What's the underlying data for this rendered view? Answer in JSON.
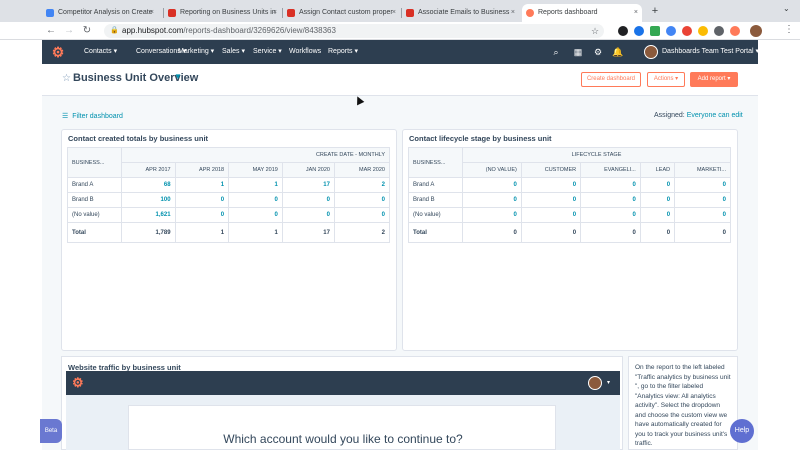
{
  "browser": {
    "tabs": [
      {
        "title": "Competitor Analysis on Create",
        "favicon_color": "#4285f4"
      },
      {
        "title": "Reporting on Business Units in",
        "favicon_color": "#d93025"
      },
      {
        "title": "Assign Contact custom proper",
        "favicon_color": "#d93025"
      },
      {
        "title": "Associate Emails to Business",
        "favicon_color": "#d93025"
      },
      {
        "title": "Reports dashboard",
        "favicon_color": "#ff7a59"
      }
    ],
    "close_glyph": "×",
    "new_tab_glyph": "+",
    "url_host": "app.hubspot.com",
    "url_path": "/reports-dashboard/3269626/view/8438363"
  },
  "hs_nav": {
    "logo_glyph": "⚙",
    "menu": [
      "Contacts ▾",
      "Conversations ▾",
      "Marketing ▾",
      "Sales ▾",
      "Service ▾",
      "Workflows",
      "Reports ▾"
    ],
    "portal_name": "Dashboards Team Test Portal ▾"
  },
  "header": {
    "star_glyph": "☆",
    "title": "Business Unit Overview",
    "caret": "▼",
    "create_dashboard": "Create dashboard",
    "actions": "Actions ▾",
    "add_report": "Add report ▾"
  },
  "filters": {
    "filter_label": "Filter dashboard",
    "assigned_label": "Assigned:",
    "assigned_value": "Everyone can edit"
  },
  "report1": {
    "title": "Contact created totals by business unit",
    "row_header": "BUSINESS...",
    "group_header": "CREATE DATE - MONTHLY",
    "columns": [
      "APR 2017",
      "APR 2018",
      "MAY 2019",
      "JAN 2020",
      "MAR 2020"
    ],
    "rows": [
      {
        "label": "Brand A",
        "values": [
          "68",
          "1",
          "1",
          "17",
          "2"
        ]
      },
      {
        "label": "Brand B",
        "values": [
          "100",
          "0",
          "0",
          "0",
          "0"
        ]
      },
      {
        "label": "(No value)",
        "values": [
          "1,621",
          "0",
          "0",
          "0",
          "0"
        ]
      }
    ],
    "total": {
      "label": "Total",
      "values": [
        "1,789",
        "1",
        "1",
        "17",
        "2"
      ]
    }
  },
  "report2": {
    "title": "Contact lifecycle stage by business unit",
    "row_header": "BUSINESS...",
    "group_header": "LIFECYCLE STAGE",
    "columns": [
      "(NO VALUE)",
      "CUSTOMER",
      "EVANGELI...",
      "LEAD",
      "MARKETI..."
    ],
    "rows": [
      {
        "label": "Brand A",
        "values": [
          "0",
          "0",
          "0",
          "0",
          "0"
        ]
      },
      {
        "label": "Brand B",
        "values": [
          "0",
          "0",
          "0",
          "0",
          "0"
        ]
      },
      {
        "label": "(No value)",
        "values": [
          "0",
          "0",
          "0",
          "0",
          "0"
        ]
      }
    ],
    "total": {
      "label": "Total",
      "values": [
        "0",
        "0",
        "0",
        "0",
        "0"
      ]
    }
  },
  "report3": {
    "title": "Website traffic by business unit",
    "modal_title": "Which account would you like to continue to?"
  },
  "note": {
    "text": "On the report to the left labeled \"Traffic analytics by business unit \", go to the filter labeled \"Analytics view: All analytics activity\". Select the dropdown and choose the custom view we have automatically created for you to track your business unit's traffic."
  },
  "widgets": {
    "beta": "Beta",
    "help": "Help"
  },
  "colors": {
    "nav_dark": "#2d3e50",
    "accent_orange": "#ff7a59",
    "link_teal": "#0091ae"
  }
}
